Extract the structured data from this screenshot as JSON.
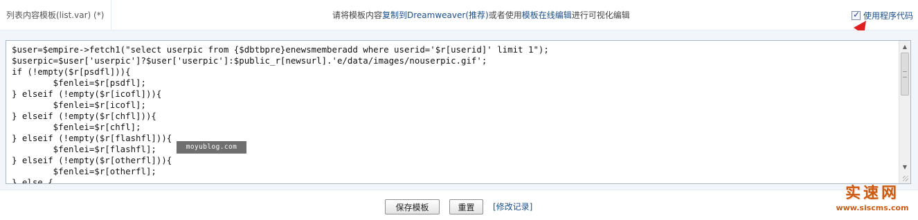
{
  "header": {
    "label": "列表内容模板(list.var) (*)",
    "center_prefix": "请将模板内容",
    "center_link1": "复制到Dreamweaver(推荐)",
    "center_mid": "或者使用",
    "center_link2": "模板在线编辑",
    "center_suffix": "进行可视化编辑",
    "use_code_label": "使用程序代码",
    "use_code_checked": true
  },
  "editor": {
    "lines": [
      "$user=$empire->fetch1(\"select userpic from {$dbtbpre}enewsmemberadd where userid='$r[userid]' limit 1\");",
      "$userpic=$user['userpic']?$user['userpic']:$public_r[newsurl].'e/data/images/nouserpic.gif';",
      "if (!empty($r[psdfl])){",
      "        $fenlei=$r[psdfl];",
      "} elseif (!empty($r[icofl])){",
      "        $fenlei=$r[icofl];",
      "} elseif (!empty($r[chfl])){",
      "        $fenlei=$r[chfl];",
      "} elseif (!empty($r[flashfl])){",
      "        $fenlei=$r[flashfl];",
      "} elseif (!empty($r[otherfl])){",
      "        $fenlei=$r[otherfl];",
      "} else {"
    ],
    "watermark": "moyublog.com"
  },
  "footer": {
    "save_label": "保存模板",
    "reset_label": "重置",
    "history_label": "[修改记录]"
  },
  "logo": {
    "name": "实速网",
    "url": "www.siscms.com"
  },
  "colors": {
    "link": "#1b4f8a",
    "annotation_arrow": "#e02020",
    "logo": "#cc5a12"
  }
}
